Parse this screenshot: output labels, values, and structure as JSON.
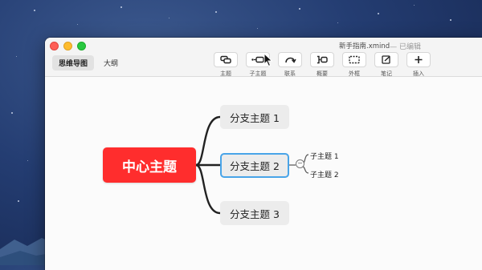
{
  "window": {
    "title": "新手指南.xmind",
    "status": "— 已编辑"
  },
  "view_tabs": [
    "思维导图",
    "大纲"
  ],
  "toolbar": [
    {
      "label": "主题",
      "icon": "topic-icon"
    },
    {
      "label": "子主题",
      "icon": "subtopic-icon"
    },
    {
      "label": "联系",
      "icon": "relationship-icon"
    },
    {
      "label": "概要",
      "icon": "summary-icon"
    },
    {
      "label": "外框",
      "icon": "boundary-icon"
    },
    {
      "label": "笔记",
      "icon": "note-icon"
    },
    {
      "label": "插入",
      "icon": "plus-icon"
    }
  ],
  "map": {
    "central": "中心主题",
    "branches": [
      "分支主题 1",
      "分支主题 2",
      "分支主题 3"
    ],
    "subtopics": [
      "子主题 1",
      "子主题 2"
    ]
  },
  "colors": {
    "central": "#ff2d2d",
    "selection": "#49a4e8",
    "branch_fill": "#ececec"
  }
}
